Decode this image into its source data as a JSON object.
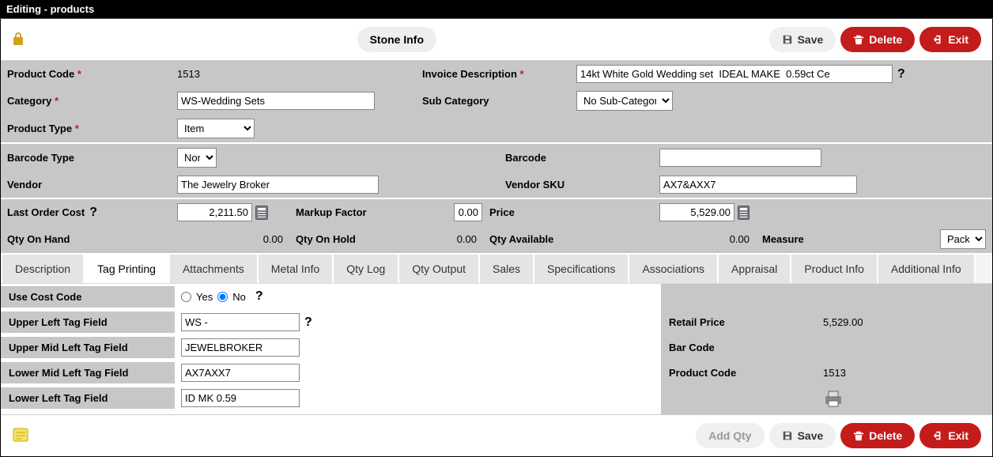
{
  "window": {
    "title": "Editing - products"
  },
  "toolbar": {
    "stone_info": "Stone Info",
    "save": "Save",
    "delete": "Delete",
    "exit": "Exit",
    "add_qty": "Add Qty"
  },
  "labels": {
    "product_code": "Product Code",
    "category": "Category",
    "product_type": "Product Type",
    "invoice_description": "Invoice Description",
    "sub_category": "Sub Category",
    "barcode_type": "Barcode Type",
    "vendor": "Vendor",
    "barcode": "Barcode",
    "vendor_sku": "Vendor SKU",
    "last_order_cost": "Last Order Cost",
    "markup_factor": "Markup Factor",
    "price": "Price",
    "qty_on_hand": "Qty On Hand",
    "qty_on_hold": "Qty On Hold",
    "qty_available": "Qty Available",
    "measure": "Measure"
  },
  "values": {
    "product_code": "1513",
    "category": "WS-Wedding Sets",
    "product_type": "Item",
    "invoice_description": "14kt White Gold Wedding set  IDEAL MAKE  0.59ct Ce",
    "sub_category": "No Sub-Category",
    "barcode_type": "None",
    "vendor": "The Jewelry Broker",
    "barcode": "",
    "vendor_sku": "AX7&AXX7",
    "last_order_cost": "2,211.50",
    "markup_factor": "0.00",
    "price": "5,529.00",
    "qty_on_hand": "0.00",
    "qty_on_hold": "0.00",
    "qty_available": "0.00",
    "measure": "Pack"
  },
  "tabs": [
    "Description",
    "Tag Printing",
    "Attachments",
    "Metal Info",
    "Qty Log",
    "Qty Output",
    "Sales",
    "Specifications",
    "Associations",
    "Appraisal",
    "Product Info",
    "Additional Info"
  ],
  "active_tab": "Tag Printing",
  "tag_printing": {
    "use_cost_code_label": "Use Cost Code",
    "yes": "Yes",
    "no": "No",
    "upper_left_label": "Upper Left Tag Field",
    "upper_left_value": "WS -",
    "upper_mid_left_label": "Upper Mid Left Tag Field",
    "upper_mid_left_value": "JEWELBROKER",
    "lower_mid_left_label": "Lower Mid Left Tag Field",
    "lower_mid_left_value": "AX7AXX7",
    "lower_left_label": "Lower Left Tag Field",
    "lower_left_value": "ID MK 0.59",
    "retail_price_label": "Retail Price",
    "retail_price_value": "5,529.00",
    "bar_code_label": "Bar Code",
    "product_code_label": "Product Code",
    "product_code_value": "1513"
  }
}
